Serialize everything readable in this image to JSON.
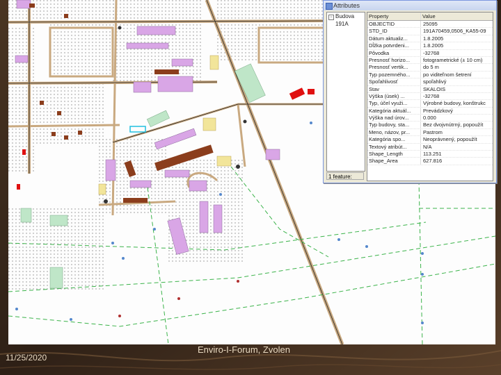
{
  "window": {
    "title": "Attributes"
  },
  "tree": {
    "layer": "Budova",
    "feature_id": "191A"
  },
  "grid": {
    "col_property": "Property",
    "col_value": "Value",
    "rows": [
      {
        "k": "OBJECTID",
        "v": "25095"
      },
      {
        "k": "STD_ID",
        "v": "191A70459,0506_KA55-09"
      },
      {
        "k": "Dátum aktualiz...",
        "v": "1.8.2005"
      },
      {
        "k": "Dĺžka potvrdeni...",
        "v": "1.8.2005"
      },
      {
        "k": "Pôvodka",
        "v": "-32768"
      },
      {
        "k": "Presnosť horizo...",
        "v": "fotogrametrické (± 10 cm)"
      },
      {
        "k": "Presnosť vertik...",
        "v": "do 5 m"
      },
      {
        "k": "Typ pozemného...",
        "v": "po viditeľnom šetrení"
      },
      {
        "k": "Spoľahlivosť",
        "v": "spoľahlivý"
      },
      {
        "k": "Stav",
        "v": "SKALOIS"
      },
      {
        "k": "Výška (úsek) ...",
        "v": "-32768"
      },
      {
        "k": "Typ, účel využi...",
        "v": "Výrobné budovy, konštrukc"
      },
      {
        "k": "Kategória aktuál...",
        "v": "Prevádzkový"
      },
      {
        "k": "Výška nad úrov...",
        "v": "0.000"
      },
      {
        "k": "Typ budovy, sta...",
        "v": "Bez dvojvnútrný, popoužít"
      },
      {
        "k": "Meno, názov, pr...",
        "v": "Pastrom"
      },
      {
        "k": "Kategória spo...",
        "v": "Neoprávnený, popoužít"
      },
      {
        "k": "Textový atribút...",
        "v": "N/A"
      },
      {
        "k": "Shape_Length",
        "v": "113.251"
      },
      {
        "k": "Shape_Area",
        "v": "627.816"
      }
    ]
  },
  "status": {
    "feature_count": "1 feature:"
  },
  "footer": {
    "date": "11/25/2020",
    "title": "Enviro-I-Forum, Zvolen"
  },
  "colors": {
    "building_violet": "#d9a6e6",
    "building_brown": "#8b3d1c",
    "building_green": "#bfe6c8",
    "building_yellow": "#f2e59a",
    "road": "#c9a980",
    "highlight_red": "#e01010"
  },
  "icons": {
    "tree_toggle": "minus-box-icon",
    "window": "table-window-icon"
  }
}
